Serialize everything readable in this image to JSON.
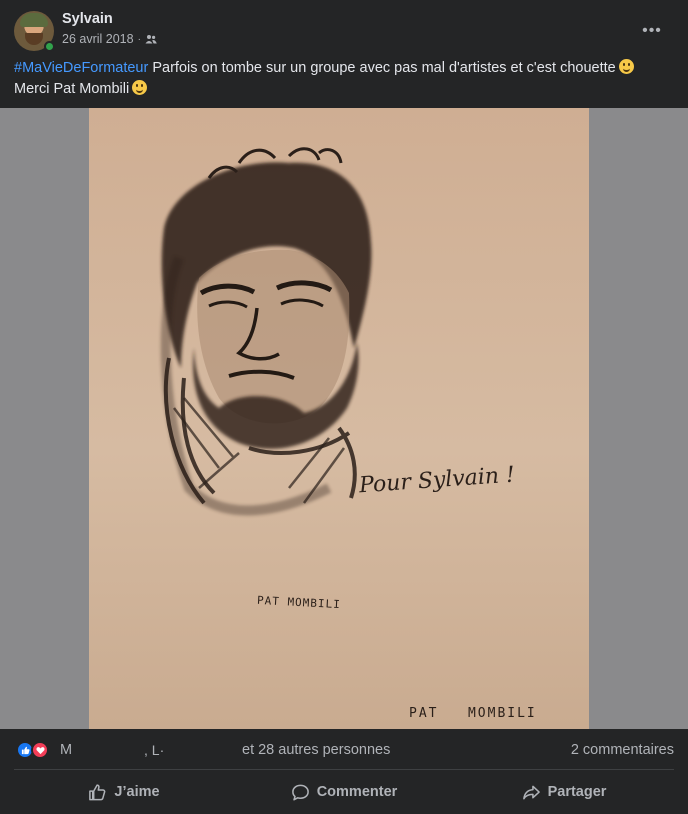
{
  "post": {
    "author": "Sylvain",
    "date": "26 avril 2018",
    "separator": "·",
    "audience_icon": "friends-icon",
    "more_label": "•••",
    "hashtag": "#MaVieDeFormateur",
    "text_line1": " Parfois on tombe sur un groupe avec pas mal d'artistes et c'est chouette",
    "text_line2": "Merci Pat Mombili"
  },
  "photo": {
    "dedication": "Pour Sylvain !",
    "signature_small": "PAT MOMBILI",
    "signature_large": "PAT   MOMBILI"
  },
  "reactions": {
    "types": [
      "like-icon",
      "love-icon"
    ],
    "name_initial": "M",
    "name_second": ", L·",
    "others": "et 28 autres personnes",
    "comments": "2 commentaires"
  },
  "actions": {
    "like": "J’aime",
    "comment": "Commenter",
    "share": "Partager"
  },
  "colors": {
    "background": "#242526",
    "text": "#e4e6eb",
    "secondary": "#b0b3b8",
    "hashtag": "#4599ff",
    "like_blue": "#1877f2",
    "love_red": "#f33e58",
    "online_green": "#31a24c"
  }
}
